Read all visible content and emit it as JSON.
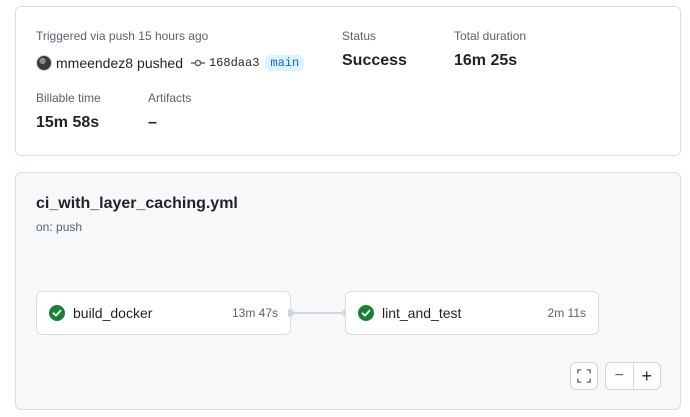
{
  "summary": {
    "trigger_text": "Triggered via push 15 hours ago",
    "actor": "mmeendez8",
    "action": "pushed",
    "commit_sha": "168daa3",
    "branch": "main",
    "status_label": "Status",
    "status_value": "Success",
    "duration_label": "Total duration",
    "duration_value": "16m 25s",
    "billable_label": "Billable time",
    "billable_value": "15m 58s",
    "artifacts_label": "Artifacts",
    "artifacts_value": "–"
  },
  "workflow": {
    "file": "ci_with_layer_caching.yml",
    "trigger": "on: push",
    "jobs": [
      {
        "name": "build_docker",
        "duration": "13m 47s",
        "status": "success"
      },
      {
        "name": "lint_and_test",
        "duration": "2m 11s",
        "status": "success"
      }
    ]
  },
  "controls": {
    "fullscreen_icon": "fullscreen-icon",
    "zoom_out_label": "−",
    "zoom_in_label": "+"
  },
  "colors": {
    "success": "#1a7f37",
    "branch_bg": "#ddf4ff",
    "branch_fg": "#0969da"
  }
}
